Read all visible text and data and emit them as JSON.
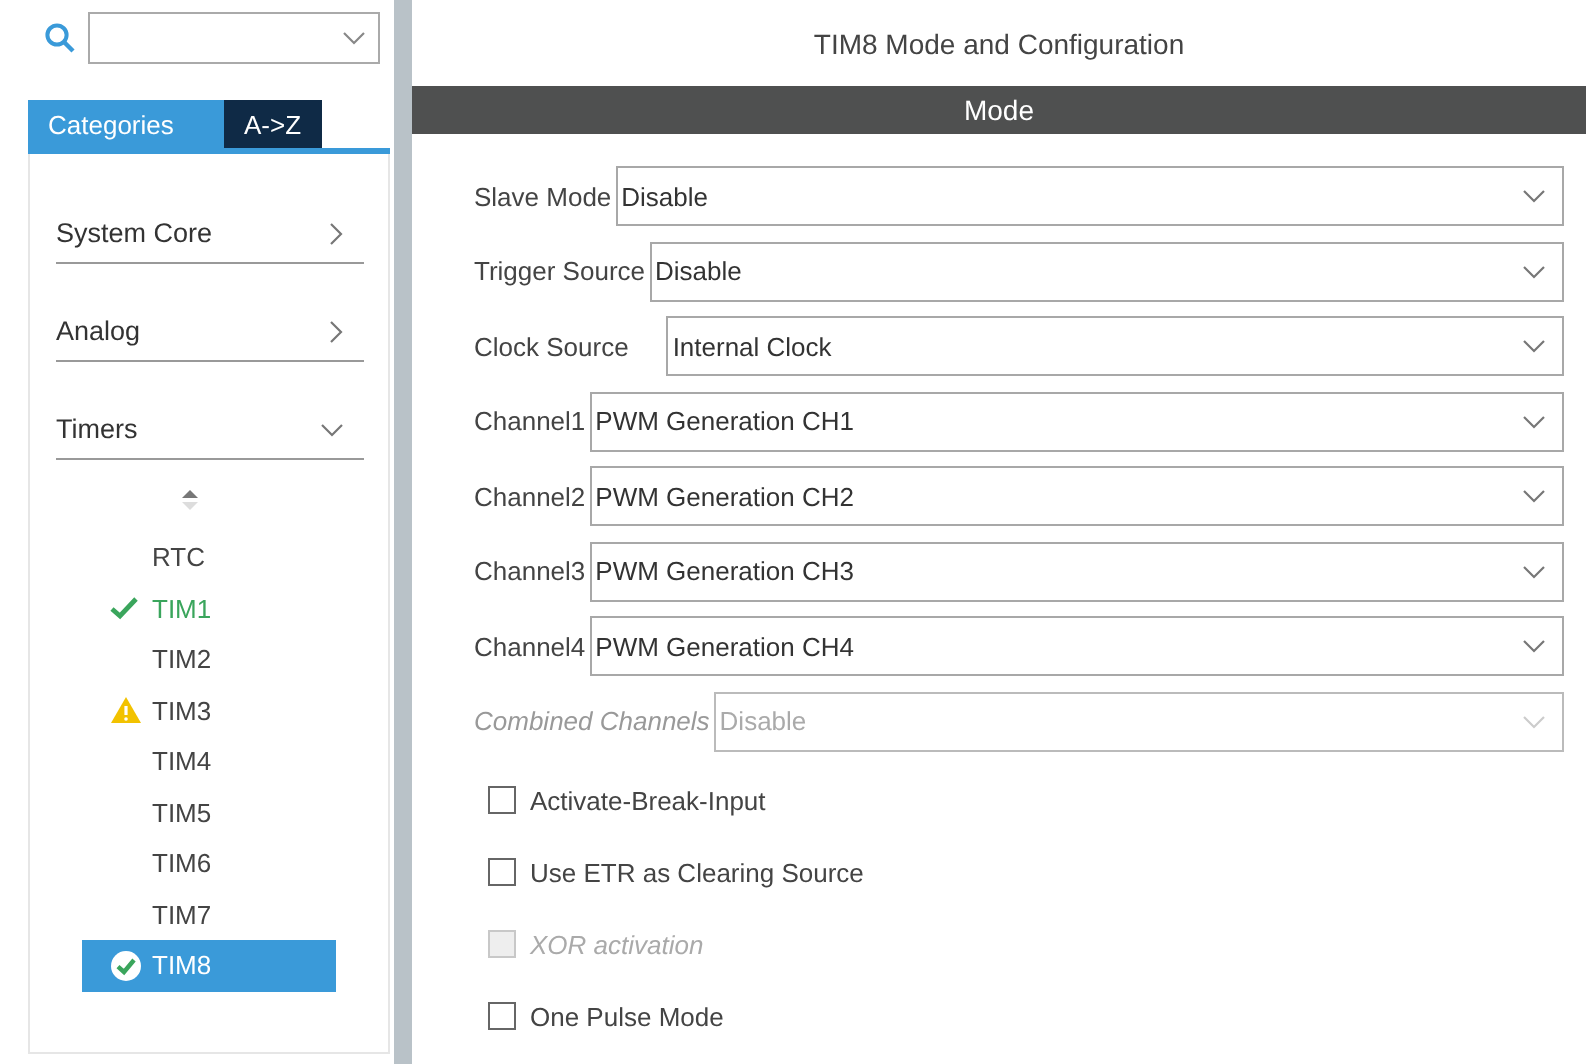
{
  "tabs": [
    {
      "label": "Categories",
      "selected": true
    },
    {
      "label": "A->Z",
      "selected": false
    }
  ],
  "categories": [
    {
      "label": "System Core",
      "expanded": false
    },
    {
      "label": "Analog",
      "expanded": false
    },
    {
      "label": "Timers",
      "expanded": true
    }
  ],
  "peripherals": [
    {
      "label": "RTC",
      "configured": false,
      "warning": false,
      "selected": false
    },
    {
      "label": "TIM1",
      "configured": true,
      "warning": false,
      "selected": false
    },
    {
      "label": "TIM2",
      "configured": false,
      "warning": false,
      "selected": false
    },
    {
      "label": "TIM3",
      "configured": false,
      "warning": true,
      "selected": false
    },
    {
      "label": "TIM4",
      "configured": false,
      "warning": false,
      "selected": false
    },
    {
      "label": "TIM5",
      "configured": false,
      "warning": false,
      "selected": false
    },
    {
      "label": "TIM6",
      "configured": false,
      "warning": false,
      "selected": false
    },
    {
      "label": "TIM7",
      "configured": false,
      "warning": false,
      "selected": false
    },
    {
      "label": "TIM8",
      "configured": true,
      "warning": false,
      "selected": true
    }
  ],
  "panel": {
    "title": "TIM8 Mode and Configuration",
    "section": "Mode"
  },
  "settings": [
    {
      "label": "Slave Mode",
      "value": "Disable",
      "disabled": false
    },
    {
      "label": "Trigger Source",
      "value": "Disable",
      "disabled": false
    },
    {
      "label": "Clock Source",
      "value": "Internal Clock",
      "disabled": false
    },
    {
      "label": "Channel1",
      "value": "PWM Generation CH1",
      "disabled": false
    },
    {
      "label": "Channel2",
      "value": "PWM Generation CH2",
      "disabled": false
    },
    {
      "label": "Channel3",
      "value": "PWM Generation CH3",
      "disabled": false
    },
    {
      "label": "Channel4",
      "value": "PWM Generation CH4",
      "disabled": false
    },
    {
      "label": "Combined Channels",
      "value": "Disable",
      "disabled": true
    }
  ],
  "options": [
    {
      "label": "Activate-Break-Input",
      "checked": false,
      "disabled": false
    },
    {
      "label": "Use ETR as Clearing Source",
      "checked": false,
      "disabled": false
    },
    {
      "label": "XOR activation",
      "checked": false,
      "disabled": true
    },
    {
      "label": "One Pulse Mode",
      "checked": false,
      "disabled": false
    }
  ]
}
